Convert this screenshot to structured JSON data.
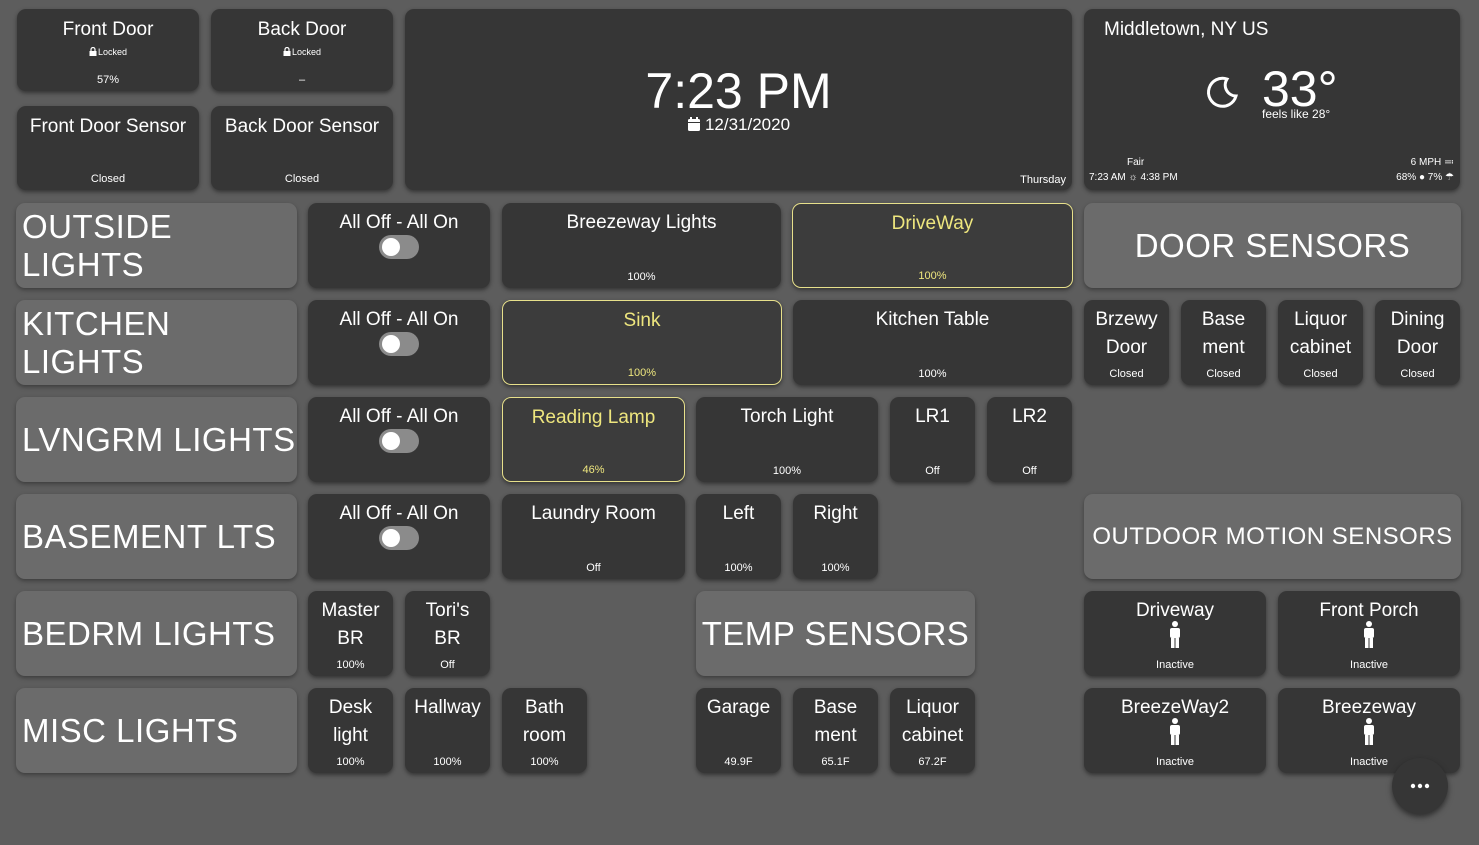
{
  "top": {
    "front_door": {
      "name": "Front Door",
      "lock": "Locked",
      "value": "57%"
    },
    "back_door": {
      "name": "Back Door",
      "lock": "Locked",
      "value": "–"
    },
    "front_sensor": {
      "name": "Front Door Sensor",
      "state": "Closed"
    },
    "back_sensor": {
      "name": "Back Door Sensor",
      "state": "Closed"
    }
  },
  "clock": {
    "time": "7:23 PM",
    "date": "12/31/2020",
    "weekday": "Thursday"
  },
  "weather": {
    "location": "Middletown, NY US",
    "temp": "33°",
    "feels": "feels like 28°",
    "condition": "Fair",
    "sunrise": "7:23 AM",
    "sunset": "4:38 PM",
    "wind": "6 MPH",
    "humidity": "68%",
    "precip": "7%"
  },
  "headers": {
    "outside": "OUTSIDE LIGHTS",
    "kitchen": "KITCHEN LIGHTS",
    "living": "LVNGRM LIGHTS",
    "basement": "BASEMENT LTS",
    "bedroom": "BEDRM LIGHTS",
    "misc": "MISC LIGHTS",
    "door_sensors": "DOOR SENSORS",
    "motion": "OUTDOOR MOTION SENSORS",
    "temp": "TEMP SENSORS"
  },
  "all_toggle_label": "All Off - All On",
  "outside": {
    "breezeway": {
      "name": "Breezeway Lights",
      "state": "100%"
    },
    "driveway": {
      "name": "DriveWay",
      "state": "100%"
    }
  },
  "kitchen": {
    "sink": {
      "name": "Sink",
      "state": "100%"
    },
    "table": {
      "name": "Kitchen Table",
      "state": "100%"
    }
  },
  "living": {
    "reading": {
      "name": "Reading Lamp",
      "state": "46%"
    },
    "torch": {
      "name": "Torch Light",
      "state": "100%"
    },
    "lr1": {
      "name": "LR1",
      "state": "Off"
    },
    "lr2": {
      "name": "LR2",
      "state": "Off"
    }
  },
  "basement": {
    "laundry": {
      "name": "Laundry Room",
      "state": "Off"
    },
    "left": {
      "name": "Left",
      "state": "100%"
    },
    "right": {
      "name": "Right",
      "state": "100%"
    }
  },
  "bedroom": {
    "master": {
      "l1": "Master",
      "l2": "BR",
      "state": "100%"
    },
    "tori": {
      "l1": "Tori's",
      "l2": "BR",
      "state": "Off"
    }
  },
  "misc": {
    "desk": {
      "l1": "Desk",
      "l2": "light",
      "state": "100%"
    },
    "hallway": {
      "name": "Hallway",
      "state": "100%"
    },
    "bath": {
      "l1": "Bath",
      "l2": "room",
      "state": "100%"
    }
  },
  "door_sensors": {
    "brzewy": {
      "l1": "Brzewy",
      "l2": "Door",
      "state": "Closed"
    },
    "basement": {
      "l1": "Base",
      "l2": "ment",
      "state": "Closed"
    },
    "liquor": {
      "l1": "Liquor",
      "l2": "cabinet",
      "state": "Closed"
    },
    "dining": {
      "l1": "Dining",
      "l2": "Door",
      "state": "Closed"
    }
  },
  "temp_sensors": {
    "garage": {
      "name": "Garage",
      "state": "49.9F"
    },
    "basement": {
      "l1": "Base",
      "l2": "ment",
      "state": "65.1F"
    },
    "liquor": {
      "l1": "Liquor",
      "l2": "cabinet",
      "state": "67.2F"
    }
  },
  "motion": {
    "driveway": {
      "name": "Driveway",
      "state": "Inactive"
    },
    "front_porch": {
      "name": "Front Porch",
      "state": "Inactive"
    },
    "breezeway2": {
      "name": "BreezeWay2",
      "state": "Inactive"
    },
    "breezeway": {
      "name": "Breezeway",
      "state": "Inactive"
    }
  },
  "colors": {
    "active": "#eee67e",
    "tile": "#363636",
    "background": "#5d5d5d"
  }
}
